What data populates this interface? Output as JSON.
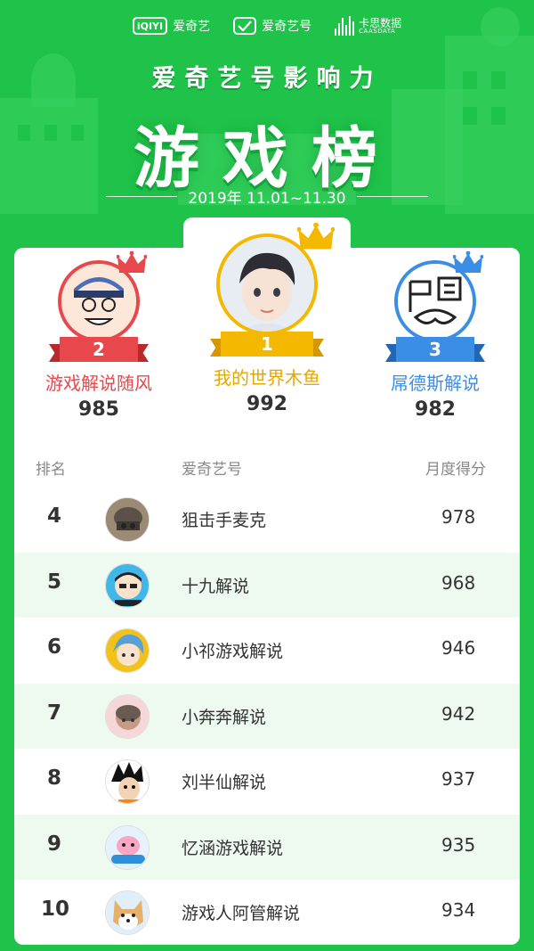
{
  "brands": {
    "iqiyi_logo": "iQIYI",
    "iqiyi_name": "爱奇艺",
    "hao_name": "爱奇艺号",
    "data_cn": "卡思数据",
    "data_en": "CAASDATA"
  },
  "header": {
    "subtitle": "爱奇艺号影响力",
    "title": "游戏榜",
    "date_range": "2019年 11.01~11.30"
  },
  "podium": [
    {
      "rank": "2",
      "name": "游戏解说随风",
      "score": "985",
      "color": "#e8474c"
    },
    {
      "rank": "1",
      "name": "我的世界木鱼",
      "score": "992",
      "color": "#f5b800"
    },
    {
      "rank": "3",
      "name": "屌德斯解说",
      "score": "982",
      "color": "#3a8ee6"
    }
  ],
  "table": {
    "col_rank": "排名",
    "col_name": "爱奇艺号",
    "col_score": "月度得分",
    "rows": [
      {
        "rank": "4",
        "name": "狙击手麦克",
        "score": "978"
      },
      {
        "rank": "5",
        "name": "十九解说",
        "score": "968"
      },
      {
        "rank": "6",
        "name": "小祁游戏解说",
        "score": "946"
      },
      {
        "rank": "7",
        "name": "小奔奔解说",
        "score": "942"
      },
      {
        "rank": "8",
        "name": "刘半仙解说",
        "score": "937"
      },
      {
        "rank": "9",
        "name": "忆涵游戏解说",
        "score": "935"
      },
      {
        "rank": "10",
        "name": "游戏人阿管解说",
        "score": "934"
      }
    ]
  },
  "colors": {
    "background": "#1fc34a",
    "row_alt": "#eef9ef",
    "gold": "#f5b800",
    "red": "#e8474c",
    "blue": "#3a8ee6"
  }
}
